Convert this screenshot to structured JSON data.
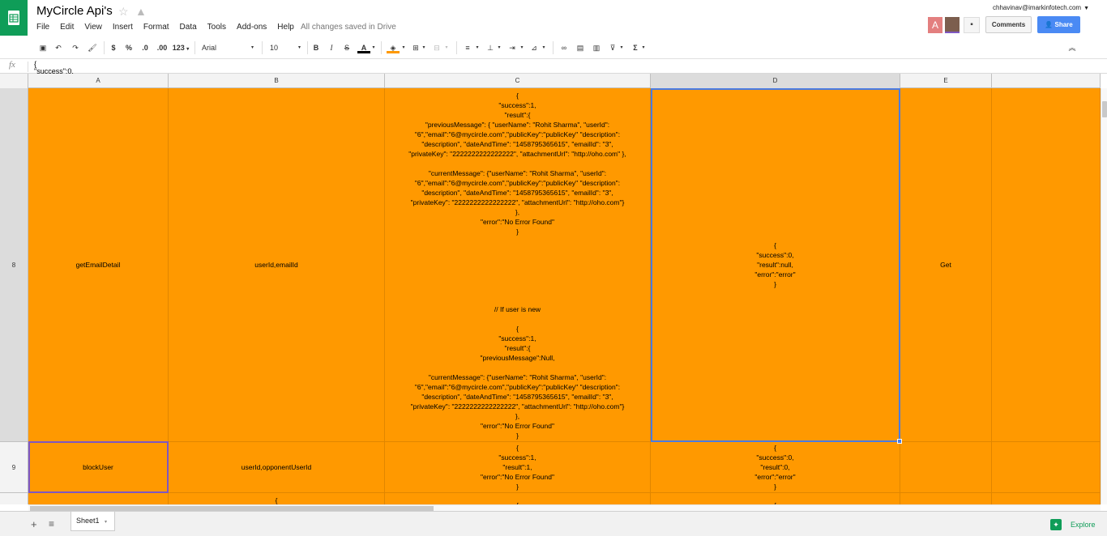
{
  "document": {
    "title": "MyCircle Api's",
    "save_status": "All changes saved in Drive",
    "user_email": "chhavinav@imarkinfotech.com"
  },
  "menu": [
    "File",
    "Edit",
    "View",
    "Insert",
    "Format",
    "Data",
    "Tools",
    "Add-ons",
    "Help"
  ],
  "header_buttons": {
    "comments": "Comments",
    "share": "Share",
    "avatar_letter": "A"
  },
  "toolbar": {
    "currency": "$",
    "percent": "%",
    "decimal_decrease": ".0",
    "decimal_increase": ".00",
    "number_format": "123",
    "font": "Arial",
    "font_size": "10",
    "bold": "B",
    "italic": "I",
    "strike": "S",
    "text_color": "A",
    "sum": "Σ"
  },
  "formula_bar": {
    "fx": "fx",
    "value": "{\n\"success\":0,"
  },
  "columns": [
    "A",
    "B",
    "C",
    "D",
    "E"
  ],
  "rows": [
    {
      "number": "8",
      "a": "getEmailDetail",
      "b": "userId,emailId",
      "c": "{\n\"success\":1,\n\"result\":{\n\"previousMessage\": { \"userName\": \"Rohit Sharma\", \"userId\":\n\"6\",\"email\":\"6@mycircle.com\",\"publicKey\":\"publicKey\" \"description\":\n\"description\", \"dateAndTime\": \"1458795365615\", \"emailId\": \"3\",\n\"privateKey\": \"2222222222222222\", \"attachmentUrl\": \"http://oho.com\" },\n\n\"currentMessage\": {\"userName\": \"Rohit Sharma\", \"userId\":\n\"6\",\"email\":\"6@mycircle.com\",\"publicKey\":\"publicKey\" \"description\":\n\"description\", \"dateAndTime\": \"1458795365615\", \"emailId\": \"3\",\n\"privateKey\": \"2222222222222222\", \"attachmentUrl\": \"http://oho.com\"}\n},\n\"error\":\"No Error Found\"\n}\n\n\n\n\n\n\n\n// If user is new\n\n{\n\"success\":1,\n\"result\":{\n\"previousMessage\":Null,\n\n\"currentMessage\": {\"userName\": \"Rohit Sharma\", \"userId\":\n\"6\",\"email\":\"6@mycircle.com\",\"publicKey\":\"publicKey\" \"description\":\n\"description\", \"dateAndTime\": \"1458795365615\", \"emailId\": \"3\",\n\"privateKey\": \"2222222222222222\", \"attachmentUrl\": \"http://oho.com\"}\n},\n\"error\":\"No Error Found\"\n}",
      "d": "{\n\"success\":0,\n\"result\":null,\n\"error\":\"error\"\n}",
      "e": "Get"
    },
    {
      "number": "9",
      "a": "blockUser",
      "b": "userId,opponentUserId",
      "c": "{\n\"success\":1,\n\"result\":1,\n\"error\":\"No Error Found\"\n}",
      "d": "{\n\"success\":0,\n\"result\":0,\n\"error\":\"error\"\n}",
      "e": ""
    },
    {
      "number": "",
      "a": "",
      "b": "{",
      "c": "{",
      "d": "{",
      "e": ""
    }
  ],
  "sheet": {
    "tab": "Sheet1",
    "explore": "Explore"
  }
}
